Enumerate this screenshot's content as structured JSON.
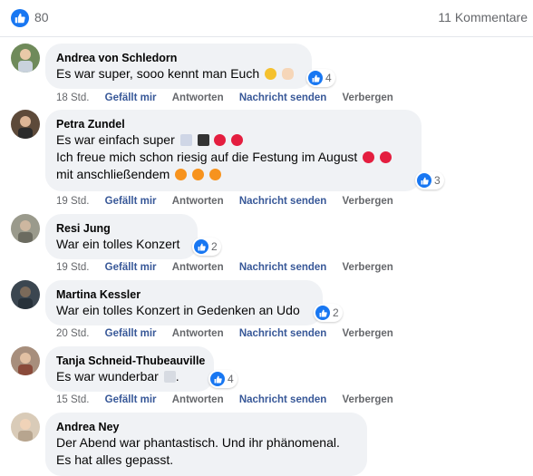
{
  "header": {
    "like_count": "80",
    "comments_label": "11 Kommentare"
  },
  "actions": {
    "like": "Gefällt mir",
    "reply": "Antworten",
    "message": "Nachricht senden",
    "hide": "Verbergen"
  },
  "comments": [
    {
      "author": "Andrea von Schledorn",
      "lines": [
        "Es war super, sooo kennt man Euch"
      ],
      "emojis": [
        "smiling-face",
        "flexed-biceps"
      ],
      "reactions": "4",
      "time": "18 Std."
    },
    {
      "author": "Petra Zundel",
      "lines": [
        "Es war einfach super",
        "Ich freue mich schon riesig auf die Festung im August",
        "mit anschließendem"
      ],
      "emojis": [
        "musical-score",
        "piano",
        "heart",
        "heart",
        "heart",
        "heart",
        "explosion",
        "explosion",
        "explosion"
      ],
      "reactions": "3",
      "time": "19 Std."
    },
    {
      "author": "Resi Jung",
      "lines": [
        "War ein tolles Konzert"
      ],
      "reactions": "2",
      "time": "19 Std."
    },
    {
      "author": "Martina Kessler",
      "lines": [
        "War ein tolles Konzert in Gedenken an Udo"
      ],
      "reactions": "2",
      "time": "20 Std."
    },
    {
      "author": "Tanja Schneid-Thubeauville",
      "lines": [
        "Es war wunderbar",
        "."
      ],
      "emojis": [
        "musical-notes"
      ],
      "reactions": "4",
      "time": "15 Std."
    },
    {
      "author": "Andrea Ney",
      "lines": [
        "Der Abend war phantastisch. Und ihr phänomenal.",
        "Es hat alles gepasst."
      ]
    }
  ],
  "colors": {
    "facebook_blue": "#1877f2",
    "bubble_gray": "#f0f2f5",
    "meta_gray": "#65676b",
    "link_blue": "#385898"
  }
}
